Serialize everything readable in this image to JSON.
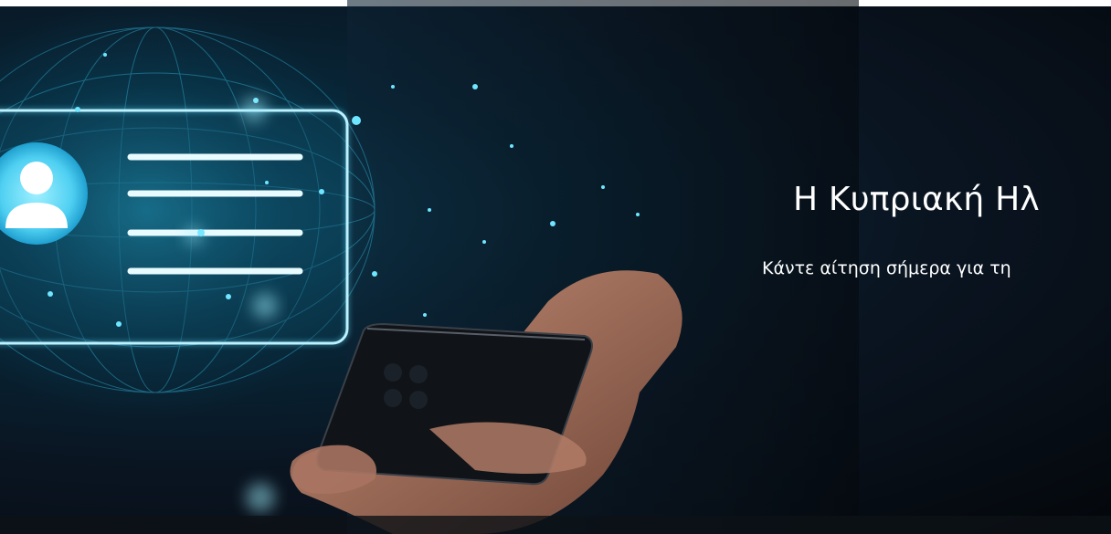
{
  "hero": {
    "headline": "Η Κυπριακή Ηλ",
    "subline": "Κάντε αίτηση σήμερα για τη"
  },
  "icons": {
    "id_card": "id-card-icon",
    "avatar": "user-avatar-icon",
    "phone": "smartphone"
  },
  "colors": {
    "glow": "#3fd3ff",
    "background": "#05080d",
    "text": "#ffffff"
  }
}
